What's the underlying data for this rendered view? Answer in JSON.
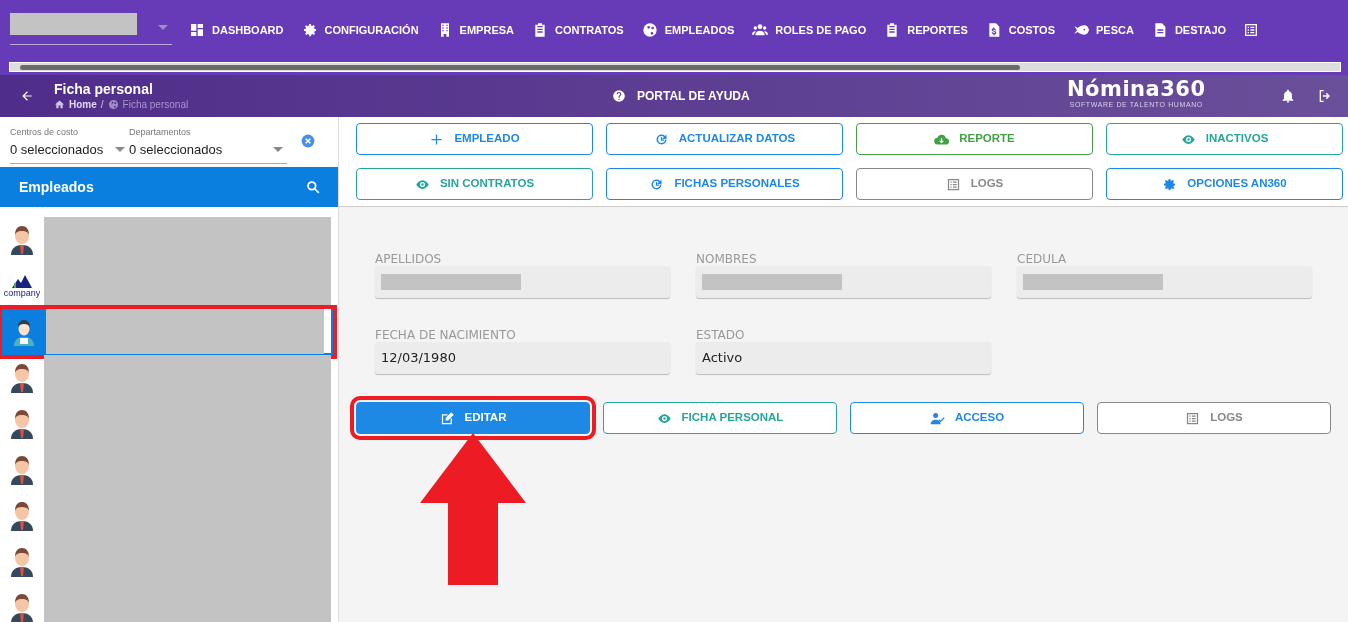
{
  "top_nav": {
    "items": [
      {
        "label": "DASHBOARD"
      },
      {
        "label": "CONFIGURACIÓN"
      },
      {
        "label": "EMPRESA"
      },
      {
        "label": "CONTRATOS"
      },
      {
        "label": "EMPLEADOS"
      },
      {
        "label": "ROLES DE PAGO"
      },
      {
        "label": "REPORTES"
      },
      {
        "label": "COSTOS"
      },
      {
        "label": "PESCA"
      },
      {
        "label": "DESTAJO"
      }
    ]
  },
  "header": {
    "title": "Ficha personal",
    "breadcrumb": [
      {
        "label": "Home"
      },
      {
        "label": "Ficha personal"
      }
    ],
    "breadcrumb_separator": "/",
    "help_link": "PORTAL DE AYUDA",
    "logo": "Nómina360",
    "logo_tagline": "SOFTWARE DE TALENTO HUMANO"
  },
  "filters": [
    {
      "label": "Centros de costo",
      "value": "0 seleccionados"
    },
    {
      "label": "Departamentos",
      "value": "0 seleccionados"
    }
  ],
  "employee_panel": {
    "title": "Empleados",
    "items": [
      {
        "kind": "person",
        "selected": false,
        "highlighted": false
      },
      {
        "kind": "logo",
        "logo_text": "company",
        "selected": false,
        "highlighted": false
      },
      {
        "kind": "person-badge",
        "selected": true,
        "highlighted": true
      },
      {
        "kind": "person",
        "selected": false,
        "highlighted": false
      },
      {
        "kind": "person",
        "selected": false,
        "highlighted": false
      },
      {
        "kind": "person",
        "selected": false,
        "highlighted": false
      },
      {
        "kind": "person",
        "selected": false,
        "highlighted": false
      },
      {
        "kind": "person",
        "selected": false,
        "highlighted": false
      },
      {
        "kind": "person",
        "selected": false,
        "highlighted": false
      }
    ]
  },
  "toolbar_buttons": [
    {
      "label": "EMPLEADO"
    },
    {
      "label": "ACTUALIZAR DATOS"
    },
    {
      "label": "REPORTE"
    },
    {
      "label": "INACTIVOS"
    },
    {
      "label": "SIN CONTRATOS"
    },
    {
      "label": "FICHAS PERSONALES"
    },
    {
      "label": "LOGS"
    },
    {
      "label": "OPCIONES AN360"
    }
  ],
  "fields": [
    {
      "label": "APELLIDOS",
      "redacted": true
    },
    {
      "label": "NOMBRES",
      "redacted": true
    },
    {
      "label": "CEDULA",
      "redacted": true
    },
    {
      "label": "FECHA DE NACIMIENTO",
      "value": "12/03/1980",
      "redacted": false
    },
    {
      "label": "ESTADO",
      "value": "Activo",
      "redacted": false
    }
  ],
  "action_buttons": [
    {
      "label": "EDITAR",
      "highlighted": true
    },
    {
      "label": "FICHA PERSONAL",
      "highlighted": false
    },
    {
      "label": "ACCESO",
      "highlighted": false
    },
    {
      "label": "LOGS",
      "highlighted": false
    }
  ]
}
